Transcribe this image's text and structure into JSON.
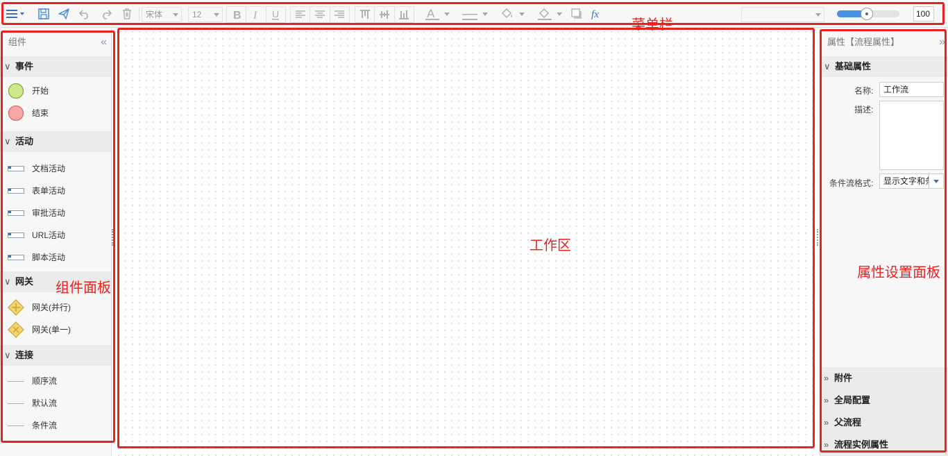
{
  "toolbar": {
    "font_family": "宋体",
    "font_size": "12",
    "zoom_value": "100",
    "zoom_level": 0.42
  },
  "components": {
    "title": "组件",
    "collapse": "«",
    "sections": [
      {
        "title": "事件",
        "items": [
          {
            "label": "开始",
            "icon": "start-event-icon"
          },
          {
            "label": "结束",
            "icon": "end-event-icon"
          }
        ]
      },
      {
        "title": "活动",
        "items": [
          {
            "label": "文档活动",
            "icon": "task-icon"
          },
          {
            "label": "表单活动",
            "icon": "task-icon"
          },
          {
            "label": "审批活动",
            "icon": "task-icon"
          },
          {
            "label": "URL活动",
            "icon": "task-icon"
          },
          {
            "label": "脚本活动",
            "icon": "task-icon"
          }
        ]
      },
      {
        "title": "网关",
        "items": [
          {
            "label": "网关(并行)",
            "icon": "parallel-gateway-icon"
          },
          {
            "label": "网关(单一)",
            "icon": "exclusive-gateway-icon"
          }
        ]
      },
      {
        "title": "连接",
        "items": [
          {
            "label": "顺序流",
            "icon": "line-icon"
          },
          {
            "label": "默认流",
            "icon": "line-icon"
          },
          {
            "label": "条件流",
            "icon": "line-icon"
          }
        ]
      }
    ]
  },
  "properties": {
    "title": "属性【流程属性】",
    "collapse": "»",
    "basic_title": "基础属性",
    "name_label": "名称:",
    "name_value": "工作流",
    "desc_label": "描述:",
    "desc_value": "",
    "cond_label": "条件流格式:",
    "cond_value": "显示文字和条",
    "sections": [
      "附件",
      "全局配置",
      "父流程",
      "流程实例属性"
    ]
  },
  "annotations": {
    "menu_bar": "菜单栏",
    "workspace": "工作区",
    "component_panel": "组件面板",
    "property_panel": "属性设置面板"
  },
  "colors": {
    "annotation": "#e8231f",
    "accent": "#3e6fb5",
    "start_event": "#cfe88a",
    "end_event": "#f7a8a6",
    "gateway": "#f5d66b"
  }
}
